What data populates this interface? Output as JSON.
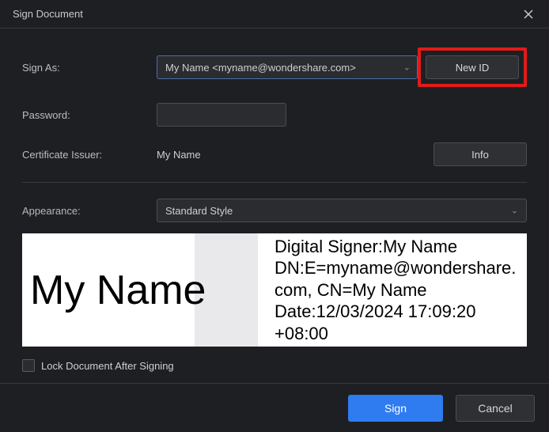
{
  "title": "Sign Document",
  "labels": {
    "sign_as": "Sign As:",
    "password": "Password:",
    "cert_issuer": "Certificate Issuer:",
    "appearance": "Appearance:",
    "lock": "Lock Document After Signing"
  },
  "sign_as": {
    "selected": "My Name <myname@wondershare.com>"
  },
  "buttons": {
    "new_id": "New ID",
    "info": "Info",
    "sign": "Sign",
    "cancel": "Cancel"
  },
  "password_value": "",
  "cert_issuer_value": "My Name",
  "appearance_selected": "Standard Style",
  "signature": {
    "display_name": "My Name",
    "line1": "Digital Signer:My Name",
    "line2": "DN:E=myname@wondershare.com, CN=My Name",
    "line3": "Date:12/03/2024 17:09:20 +08:00"
  },
  "lock_checked": false
}
